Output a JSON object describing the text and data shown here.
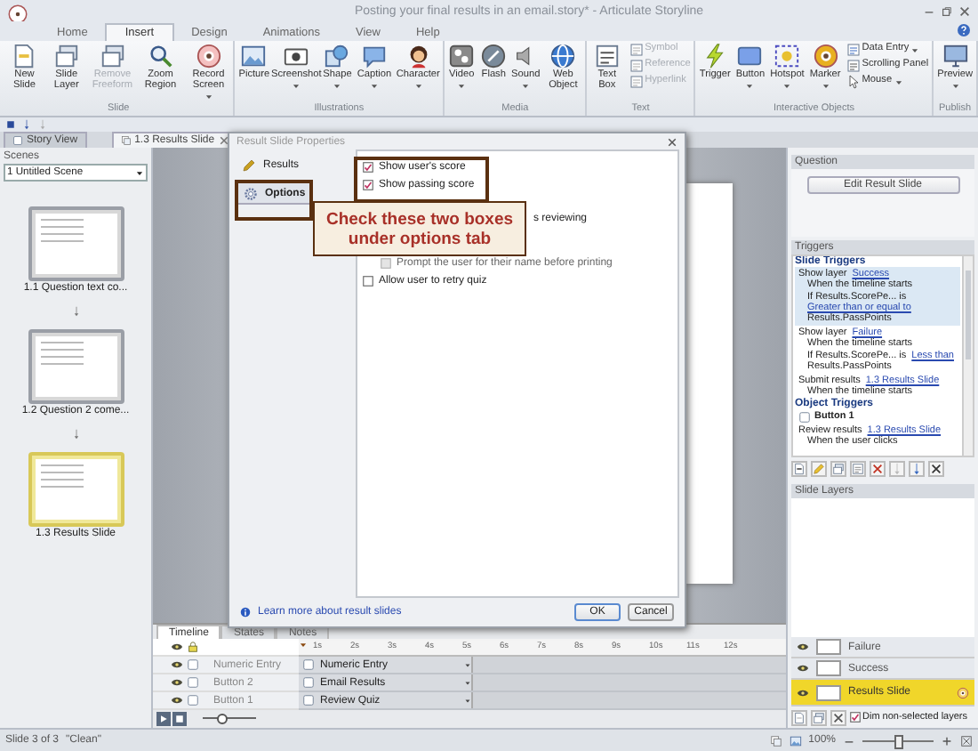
{
  "window": {
    "title": "Posting your final results in an email.story* - Articulate Storyline"
  },
  "ribbon_tabs": [
    {
      "label": "Home",
      "selected": false
    },
    {
      "label": "Insert",
      "selected": true
    },
    {
      "label": "Design",
      "selected": false
    },
    {
      "label": "Animations",
      "selected": false
    },
    {
      "label": "View",
      "selected": false
    },
    {
      "label": "Help",
      "selected": false
    }
  ],
  "ribbon_groups": [
    {
      "label": "Slide",
      "buttons": [
        {
          "kind": "large",
          "label": "New Slide",
          "disabled": false,
          "menu": false
        },
        {
          "kind": "large",
          "label": "Slide Layer",
          "disabled": false,
          "menu": false
        },
        {
          "kind": "large",
          "label": "Remove Freeform",
          "disabled": true,
          "menu": false
        },
        {
          "kind": "large",
          "label": "Zoom Region",
          "disabled": false,
          "menu": false
        },
        {
          "kind": "large",
          "label": "Record Screen",
          "disabled": false,
          "menu": true
        }
      ]
    },
    {
      "label": "Illustrations",
      "buttons": [
        {
          "kind": "large",
          "label": "Picture",
          "disabled": false,
          "menu": false
        },
        {
          "kind": "large",
          "label": "Screenshot",
          "disabled": false,
          "menu": true
        },
        {
          "kind": "large",
          "label": "Shape",
          "disabled": false,
          "menu": true
        },
        {
          "kind": "large",
          "label": "Caption",
          "disabled": false,
          "menu": true
        },
        {
          "kind": "large",
          "label": "Character",
          "disabled": false,
          "menu": true
        }
      ]
    },
    {
      "label": "Media",
      "buttons": [
        {
          "kind": "large",
          "label": "Video",
          "disabled": false,
          "menu": true
        },
        {
          "kind": "large",
          "label": "Flash",
          "disabled": false,
          "menu": false
        },
        {
          "kind": "large",
          "label": "Sound",
          "disabled": false,
          "menu": true
        },
        {
          "kind": "large",
          "label": "Web Object",
          "disabled": false,
          "menu": false
        }
      ]
    },
    {
      "label": "Text",
      "buttons": [
        {
          "kind": "large",
          "label": "Text Box",
          "disabled": false,
          "menu": false
        },
        {
          "kind": "small",
          "label": "Symbol",
          "disabled": true,
          "menu": false
        },
        {
          "kind": "small",
          "label": "Reference",
          "disabled": true,
          "menu": false
        },
        {
          "kind": "small",
          "label": "Hyperlink",
          "disabled": true,
          "menu": false
        }
      ]
    },
    {
      "label": "Interactive Objects",
      "buttons": [
        {
          "kind": "large",
          "label": "Trigger",
          "disabled": false,
          "menu": false
        },
        {
          "kind": "large",
          "label": "Button",
          "disabled": false,
          "menu": true
        },
        {
          "kind": "large",
          "label": "Hotspot",
          "disabled": false,
          "menu": true
        },
        {
          "kind": "large",
          "label": "Marker",
          "disabled": false,
          "menu": true
        },
        {
          "kind": "small",
          "label": "Data Entry",
          "disabled": false,
          "menu": true
        },
        {
          "kind": "small",
          "label": "Scrolling Panel",
          "disabled": false,
          "menu": false
        },
        {
          "kind": "small",
          "label": "Mouse",
          "disabled": false,
          "menu": true
        }
      ]
    },
    {
      "label": "Publish",
      "buttons": [
        {
          "kind": "large",
          "label": "Preview",
          "disabled": false,
          "menu": true
        }
      ]
    }
  ],
  "view_tabs": [
    {
      "label": "Story View",
      "selected": false
    },
    {
      "label": "1.3 Results Slide",
      "selected": true
    }
  ],
  "scenes": {
    "title": "Scenes",
    "scene_select": "1 Untitled Scene",
    "slides": [
      {
        "label": "1.1 Question text co...",
        "selected": false
      },
      {
        "label": "1.2 Question 2 come...",
        "selected": false
      },
      {
        "label": "1.3 Results Slide",
        "selected": true
      }
    ]
  },
  "dialog": {
    "title": "Result Slide Properties",
    "nav": [
      {
        "label": "Results",
        "selected": false
      },
      {
        "label": "Options",
        "selected": true
      }
    ],
    "options": [
      {
        "kind": "checkbox",
        "label": "Show user's score",
        "checked": true,
        "disabled": false
      },
      {
        "kind": "checkbox",
        "label": "Show passing score",
        "checked": true,
        "disabled": false
      },
      {
        "kind": "partial",
        "label": "s reviewing"
      },
      {
        "kind": "checkbox",
        "label": "Prompt the user for their name before printing",
        "checked": false,
        "disabled": true
      },
      {
        "kind": "checkbox",
        "label": "Allow user to retry quiz",
        "checked": false,
        "disabled": false
      }
    ],
    "help_link": "Learn more about result slides",
    "buttons": [
      "OK",
      "Cancel"
    ]
  },
  "annotation": {
    "text": "Check these two boxes under options tab"
  },
  "timeline": {
    "tabs": [
      {
        "label": "Timeline",
        "selected": true
      },
      {
        "label": "States",
        "selected": false
      },
      {
        "label": "Notes",
        "selected": false
      }
    ],
    "ruler": [
      "1s",
      "2s",
      "3s",
      "4s",
      "5s",
      "6s",
      "7s",
      "8s",
      "9s",
      "10s",
      "11s",
      "12s"
    ],
    "rows": [
      {
        "name": "Numeric Entry",
        "bar": "Numeric Entry"
      },
      {
        "name": "Button 2",
        "bar": "Email Results"
      },
      {
        "name": "Button 1",
        "bar": "Review Quiz"
      }
    ],
    "zoom": {
      "level": 0.35
    }
  },
  "question": {
    "title": "Question",
    "button": "Edit Result Slide"
  },
  "triggers": {
    "title": "Triggers",
    "sections": [
      {
        "title": "Slide Triggers",
        "items": [
          {
            "kind": "trigger",
            "selected": true,
            "lines": [
              {
                "kind": "action",
                "text": "Show layer",
                "link": "Success"
              },
              {
                "kind": "condition",
                "text": "When the timeline starts"
              },
              {
                "kind": "condition",
                "text": "If Results.ScorePe... is"
              },
              {
                "kind": "condition",
                "link": "Greater than or equal to"
              },
              {
                "kind": "condition",
                "text": "Results.PassPoints"
              }
            ]
          },
          {
            "kind": "trigger",
            "selected": false,
            "lines": [
              {
                "kind": "action",
                "text": "Show layer",
                "link": "Failure"
              },
              {
                "kind": "condition",
                "text": "When the timeline starts"
              },
              {
                "kind": "condition",
                "text": "If Results.ScorePe... is",
                "link": "Less than"
              },
              {
                "kind": "condition",
                "text": "Results.PassPoints"
              }
            ]
          },
          {
            "kind": "trigger",
            "selected": false,
            "lines": [
              {
                "kind": "action",
                "text": "Submit results",
                "link": "1.3 Results Slide"
              },
              {
                "kind": "condition",
                "text": "When the timeline starts"
              }
            ]
          }
        ]
      },
      {
        "title": "Object Triggers",
        "items": [
          {
            "kind": "object",
            "label": "Button 1"
          },
          {
            "kind": "trigger",
            "selected": false,
            "lines": [
              {
                "kind": "action",
                "text": "Review results",
                "link": "1.3 Results Slide"
              },
              {
                "kind": "condition",
                "text": "When the user clicks"
              }
            ]
          }
        ]
      }
    ]
  },
  "layers": {
    "title": "Slide Layers",
    "items": [
      {
        "name": "Failure",
        "selected": false
      },
      {
        "name": "Success",
        "selected": false
      },
      {
        "name": "Results Slide",
        "selected": true
      }
    ],
    "dim": {
      "label": "Dim non-selected layers",
      "checked": true
    }
  },
  "status_bar": {
    "slide": "Slide 3 of 3",
    "theme": "\"Clean\"",
    "zoom": "100%",
    "zoom_slider": {
      "level": 0.5
    }
  }
}
